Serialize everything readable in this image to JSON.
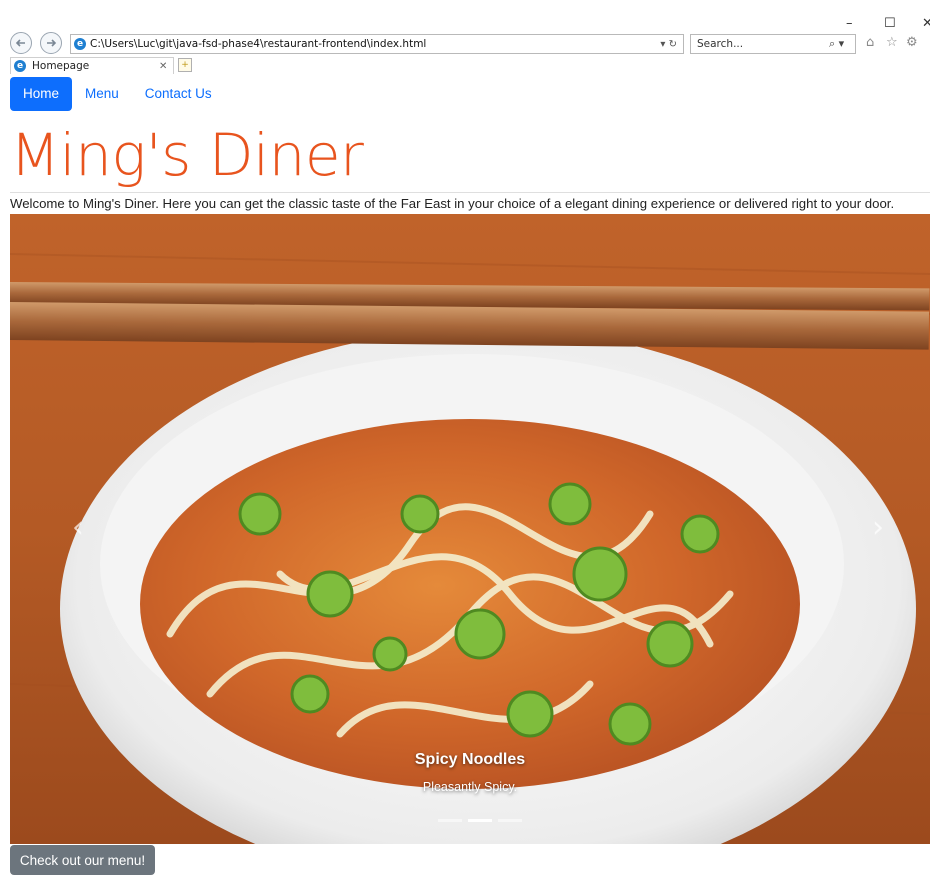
{
  "browser": {
    "address": "C:\\Users\\Luc\\git\\java-fsd-phase4\\restaurant-frontend\\index.html",
    "search_placeholder": "Search...",
    "tab_title": "Homepage",
    "window_controls": {
      "minimize": "–",
      "maximize": "☐",
      "close": "✕"
    }
  },
  "nav": {
    "home": "Home",
    "menu": "Menu",
    "contact": "Contact Us"
  },
  "page": {
    "title": "Ming's Diner",
    "welcome": "Welcome to Ming's Diner. Here you can get the classic taste of the Far East in your choice of a elegant dining experience or delivered right to your door."
  },
  "carousel": {
    "slide_title": "Spicy Noodles",
    "slide_caption": "Pleasantly Spicy.",
    "slide_count": 3,
    "active_slide": 2,
    "prev": "‹",
    "next": "›"
  },
  "cta": {
    "menu_button": "Check out our menu!"
  },
  "colors": {
    "primary": "#0d6efd",
    "title": "#e8541e",
    "secondary_button": "#6c757d"
  }
}
